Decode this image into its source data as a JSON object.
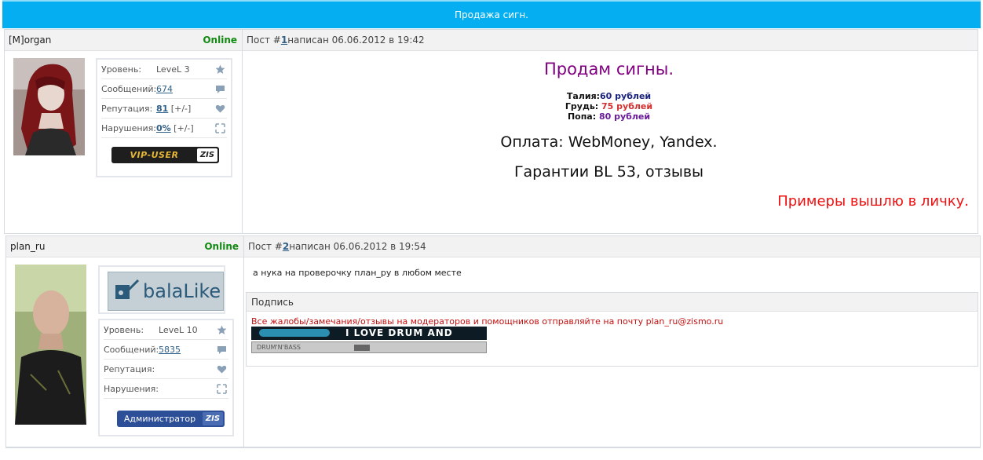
{
  "topic_title": "Продажа сигн.",
  "posts": [
    {
      "username": "[M]organ",
      "online": "Online",
      "header": {
        "prefix": "Пост #",
        "num": "1",
        "suffix": " написан 06.06.2012 в 19:42"
      },
      "profile": {
        "level_label": "Уровень:",
        "level_value": "LeveL 3",
        "messages_label": "Сообщений:",
        "messages_value": "674",
        "rep_label": "Репутация:",
        "rep_value": "81",
        "rep_extra": " [+/-]",
        "viol_label": "Нарушения:",
        "viol_value": "0%",
        "viol_extra": " [+/-]"
      },
      "badge": {
        "text": "VIP-USER",
        "brand": "ZIS"
      },
      "body": {
        "title": "Продам сигны.",
        "line1_label": "Талия:",
        "line1_value": "60 рублей",
        "line2_label": "Грудь: ",
        "line2_value": "75 рублей",
        "line3_label": "Попа: ",
        "line3_value": "80 рублей",
        "payment": "Оплата: WebMoney, Yandex.",
        "guarantee": "Гарантии BL 53, отзывы",
        "examples": "Примеры вышлю в личку."
      }
    },
    {
      "username": "plan_ru",
      "online": "Online",
      "header": {
        "prefix": "Пост #",
        "num": "2",
        "suffix": " написан 06.06.2012 в 19:54"
      },
      "logo": "balaLike",
      "profile": {
        "level_label": "Уровень:",
        "level_value": "LeveL 10",
        "messages_label": "Сообщений:",
        "messages_value": "5835",
        "rep_label": "Репутация:",
        "viol_label": "Нарушения:"
      },
      "badge": {
        "text": "Администратор",
        "brand": "ZIS"
      },
      "body": {
        "text": "а нука на проверочку план_ру в любом месте",
        "sig_title": "Подпись",
        "sig_text": "Все жалобы/замечания/отзывы на модераторов и помощников отправляйте на почту plan_ru@zismo.ru",
        "banner1": "I LOVE DRUM AND BASS",
        "banner2": "DRUM'N'BASS"
      }
    }
  ],
  "colors": {
    "topbar": "#04aef0",
    "online": "#138a13",
    "title_purple": "#800080",
    "red": "#ee1111"
  },
  "icons": [
    "star-icon",
    "comment-icon",
    "heart-icon",
    "expand-icon"
  ]
}
